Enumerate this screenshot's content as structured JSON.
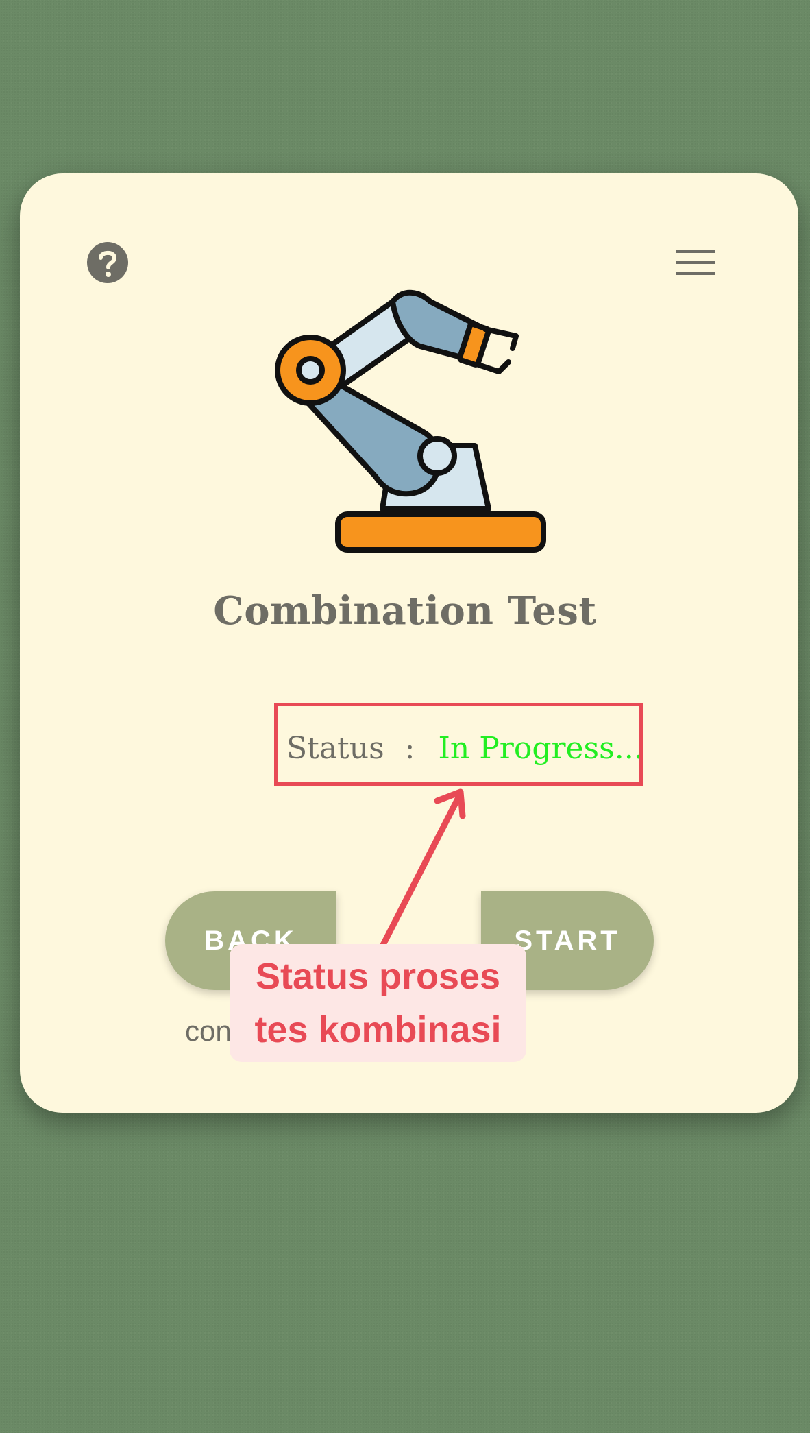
{
  "screen": {
    "title": "Combination Test",
    "status": {
      "label": "Status",
      "separator": ":",
      "value": "In Progress..."
    },
    "buttons": {
      "back": "BACK",
      "start": "START"
    },
    "footer_text": "con"
  },
  "annotation": {
    "line1": "Status proses",
    "line2": "tes kombinasi"
  },
  "icons": {
    "help": "help-circle-icon",
    "menu": "hamburger-menu-icon",
    "illustration": "robot-arm-icon"
  },
  "colors": {
    "background": "#6b8a66",
    "card": "#fef8dd",
    "button": "#a9b286",
    "status_value": "#22ee22",
    "annotation": "#e84a55"
  }
}
